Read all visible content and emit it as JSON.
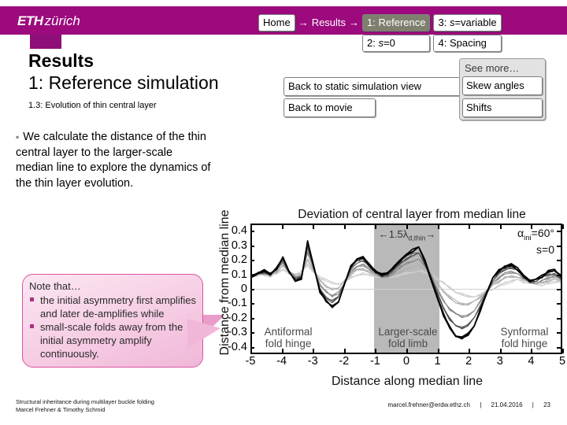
{
  "header": {
    "logo_eth": "ETH",
    "logo_zurich": "zürich",
    "bar_color": "#9c0a7d"
  },
  "breadcrumb": {
    "home_label": "Home",
    "sep1": "→",
    "results_label": "Results",
    "sep2": "→",
    "items": [
      {
        "label": "1: Reference",
        "active": true
      },
      {
        "label": "3: s=variable",
        "active": false
      },
      {
        "label": "2: s=0",
        "active": false
      },
      {
        "label": "4: Spacing",
        "active": false
      }
    ]
  },
  "title": {
    "main": "Results",
    "sub": "1: Reference simulation",
    "small": "1.3:  Evolution of thin central layer"
  },
  "actions": {
    "back_static": "Back to static simulation view",
    "back_movie": "Back to movie",
    "see_more_label": "See more…",
    "see_more_items": [
      "Skew angles",
      "Shifts"
    ]
  },
  "bullets": [
    "We calculate the distance of the thin central layer to the larger-scale median line to explore the dynamics of the thin layer evolution."
  ],
  "callout": {
    "head": "Note that…",
    "items": [
      "the initial asymmetry first amplifies and later de-amplifies while",
      "small-scale folds away from the initial asymmetry amplify continuously."
    ]
  },
  "chart_data": {
    "type": "line",
    "title": "Deviation of central layer from median line",
    "xlabel": "Distance along median line",
    "ylabel": "Distance from median line",
    "xlim": [
      -5,
      5
    ],
    "ylim": [
      -0.45,
      0.45
    ],
    "xticks": [
      "-5",
      "-4",
      "-3",
      "-2",
      "-1",
      "0",
      "1",
      "2",
      "3",
      "4",
      "5"
    ],
    "yticks": [
      "0.4",
      "0.3",
      "0.2",
      "0.1",
      "0",
      "-0.1",
      "-0.2",
      "-0.3",
      "-0.4"
    ],
    "grid": false,
    "legend": "none",
    "annotations": [
      {
        "name": "band-width",
        "text": "←1.5λ",
        "sub": "d,thin",
        "text_end": "→"
      },
      {
        "name": "alpha-ini",
        "text": "α",
        "sub": "ini",
        "text_end": "=60°"
      },
      {
        "name": "s-value",
        "text": "s=0"
      }
    ],
    "shaded_band": {
      "x_start": -1.1,
      "x_end": 1.1,
      "color": "#b9b9b9"
    },
    "region_labels": [
      {
        "line1": "Antiformal",
        "line2": "fold hinge",
        "x": -3.5
      },
      {
        "line1": "Larger-scale",
        "line2": "fold limb",
        "x": 0
      },
      {
        "line1": "Synformal",
        "line2": "fold hinge",
        "x": 3.5
      }
    ],
    "series": [
      {
        "name": "timestep-1",
        "shade": "#cfcfcf",
        "y": [
          0.09,
          0.1,
          0.1,
          0.09,
          0.11,
          0.13,
          0.11,
          0.1,
          0.12,
          0.17,
          0.12,
          0.08,
          0.06,
          0.04,
          0.03,
          0.05,
          0.08,
          0.1,
          0.11,
          0.1,
          0.09,
          0.08,
          0.08,
          0.09,
          0.1,
          0.11,
          0.12,
          0.13,
          0.12,
          0.1,
          0.07,
          0.04,
          0.01,
          -0.02,
          -0.04,
          -0.05,
          -0.05,
          -0.04,
          -0.02,
          0.0,
          0.02,
          0.04,
          0.05,
          0.06,
          0.05,
          0.04,
          0.03,
          0.03,
          0.04,
          0.05,
          0.05
        ]
      },
      {
        "name": "timestep-2",
        "shade": "#b0b0b0",
        "y": [
          0.09,
          0.1,
          0.11,
          0.1,
          0.12,
          0.16,
          0.12,
          0.09,
          0.1,
          0.21,
          0.13,
          0.06,
          0.02,
          0.0,
          0.01,
          0.05,
          0.1,
          0.13,
          0.14,
          0.12,
          0.1,
          0.08,
          0.08,
          0.1,
          0.12,
          0.14,
          0.16,
          0.17,
          0.14,
          0.1,
          0.04,
          -0.02,
          -0.06,
          -0.09,
          -0.11,
          -0.11,
          -0.09,
          -0.06,
          -0.02,
          0.02,
          0.05,
          0.08,
          0.09,
          0.09,
          0.07,
          0.05,
          0.04,
          0.05,
          0.06,
          0.07,
          0.06
        ]
      },
      {
        "name": "timestep-3",
        "shade": "#8a8a8a",
        "y": [
          0.09,
          0.1,
          0.11,
          0.1,
          0.13,
          0.18,
          0.12,
          0.08,
          0.09,
          0.26,
          0.14,
          0.03,
          -0.02,
          -0.05,
          -0.03,
          0.04,
          0.12,
          0.16,
          0.17,
          0.14,
          0.11,
          0.09,
          0.09,
          0.12,
          0.15,
          0.18,
          0.2,
          0.21,
          0.16,
          0.09,
          0.0,
          -0.08,
          -0.14,
          -0.18,
          -0.2,
          -0.19,
          -0.15,
          -0.09,
          -0.02,
          0.04,
          0.08,
          0.11,
          0.12,
          0.11,
          0.08,
          0.05,
          0.04,
          0.06,
          0.08,
          0.09,
          0.07
        ]
      },
      {
        "name": "timestep-4",
        "shade": "#4d4d4d",
        "y": [
          0.09,
          0.1,
          0.12,
          0.1,
          0.14,
          0.2,
          0.12,
          0.07,
          0.08,
          0.3,
          0.15,
          0.0,
          -0.06,
          -0.09,
          -0.06,
          0.04,
          0.14,
          0.19,
          0.2,
          0.16,
          0.12,
          0.09,
          0.1,
          0.14,
          0.18,
          0.21,
          0.24,
          0.25,
          0.18,
          0.08,
          -0.03,
          -0.13,
          -0.21,
          -0.26,
          -0.28,
          -0.26,
          -0.21,
          -0.12,
          -0.03,
          0.06,
          0.11,
          0.14,
          0.15,
          0.13,
          0.09,
          0.05,
          0.05,
          0.08,
          0.1,
          0.11,
          0.08
        ]
      },
      {
        "name": "timestep-5",
        "shade": "#000000",
        "y": [
          0.09,
          0.11,
          0.13,
          0.1,
          0.15,
          0.22,
          0.12,
          0.06,
          0.07,
          0.33,
          0.16,
          -0.02,
          -0.09,
          -0.13,
          -0.09,
          0.04,
          0.16,
          0.21,
          0.22,
          0.17,
          0.12,
          0.1,
          0.11,
          0.15,
          0.2,
          0.24,
          0.27,
          0.29,
          0.2,
          0.07,
          -0.06,
          -0.18,
          -0.27,
          -0.33,
          -0.35,
          -0.32,
          -0.26,
          -0.15,
          -0.03,
          0.07,
          0.13,
          0.16,
          0.17,
          0.14,
          0.09,
          0.05,
          0.06,
          0.09,
          0.12,
          0.13,
          0.09
        ]
      }
    ]
  },
  "footer": {
    "left_line1": "Structural inheritance during multilayer buckle folding",
    "left_line2": "Marcel Frehner & Timothy Schmid",
    "email": "marcel.frehner@erdw.ethz.ch",
    "sep": "|",
    "date": "21.04.2016",
    "page": "23"
  }
}
